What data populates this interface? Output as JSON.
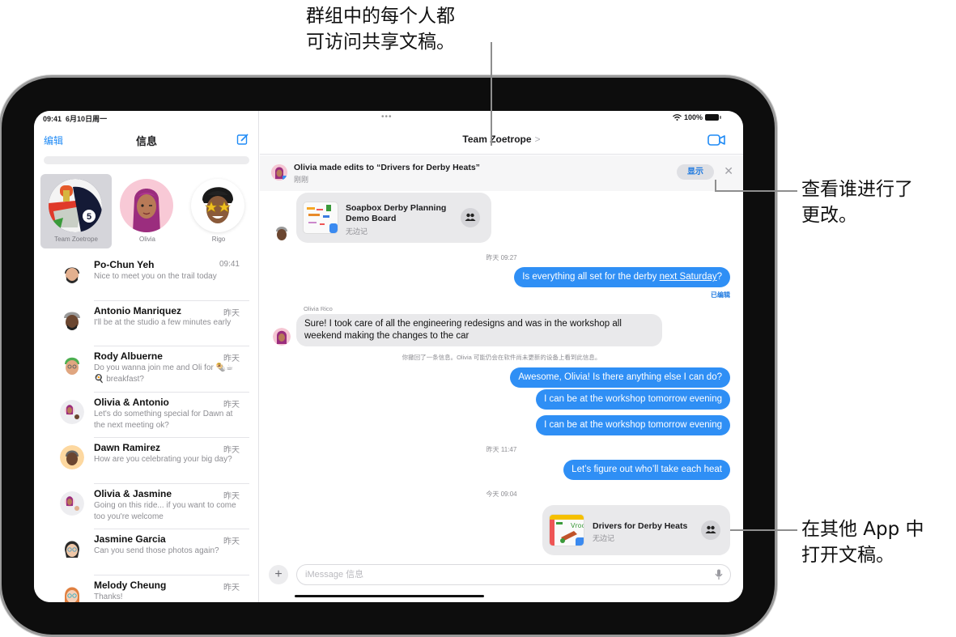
{
  "callouts": {
    "top": [
      "群组中的每个人都",
      "可访问共享文稿。"
    ],
    "right_show": [
      "查看谁进行了",
      "更改。"
    ],
    "right_open": [
      "在其他 App 中",
      "打开文稿。"
    ]
  },
  "status_bar": {
    "time": "09:41",
    "date": "6月10日周一",
    "battery": "100%"
  },
  "sidebar": {
    "edit_label": "编辑",
    "title": "信息",
    "pinned": [
      {
        "name": "Team Zoetrope",
        "selected": true
      },
      {
        "name": "Olivia",
        "selected": false
      },
      {
        "name": "Rigo",
        "selected": false
      }
    ],
    "conversations": [
      {
        "name": "Po-Chun Yeh",
        "time": "09:41",
        "preview": "Nice to meet you on the trail today"
      },
      {
        "name": "Antonio Manriquez",
        "time": "昨天",
        "preview": "I'll be at the studio a few minutes early"
      },
      {
        "name": "Rody Albuerne",
        "time": "昨天",
        "preview": "Do you wanna join me and Oli for 🌯☕🍳 breakfast?"
      },
      {
        "name": "Olivia & Antonio",
        "time": "昨天",
        "preview": "Let's do something special for Dawn at the next meeting ok?"
      },
      {
        "name": "Dawn Ramirez",
        "time": "昨天",
        "preview": "How are you celebrating your big day?"
      },
      {
        "name": "Olivia & Jasmine",
        "time": "昨天",
        "preview": "Going on this ride... if you want to come too you're welcome"
      },
      {
        "name": "Jasmine Garcia",
        "time": "昨天",
        "preview": "Can you send those photos again?"
      },
      {
        "name": "Melody Cheung",
        "time": "昨天",
        "preview": "Thanks!"
      }
    ]
  },
  "chat": {
    "title": "Team Zoetrope",
    "title_chevron": ">",
    "notification": {
      "title": "Olivia made edits to “Drivers for Derby Heats”",
      "subtitle": "刚刚",
      "show_label": "显示",
      "close_glyph": "✕"
    },
    "messages": {
      "card1": {
        "title_line1": "Soapbox Derby Planning",
        "title_line2": "Demo Board",
        "app": "无边记"
      },
      "ts1": "昨天 09:27",
      "out1_prefix": "Is everything all set for the derby ",
      "out1_link": "next Saturday",
      "out1_suffix": "?",
      "edited_label": "已编辑",
      "sender_olivia": "Olivia Rico",
      "in1_line1": "Sure! I took care of all the engineering redesigns and was in the workshop all",
      "in1_line2": "weekend making the changes to the car",
      "unsent_notice": "你撤回了一条信息。Olivia 可能仍会在软件尚未更新的设备上看到此信息。",
      "out2": "Awesome, Olivia! Is there anything else I can do?",
      "out3": "I can be at the workshop tomorrow evening",
      "out4": "I can be at the workshop tomorrow evening",
      "ts2": "昨天 11:47",
      "out5": "Let’s figure out who’ll take each heat",
      "ts3": "今天 09:04",
      "card2": {
        "title": "Drivers for Derby Heats",
        "app": "无边记"
      }
    },
    "composer": {
      "plus_glyph": "+",
      "placeholder": "iMessage 信息"
    }
  },
  "colors": {
    "accent": "#1f8af5",
    "outgoing_bubble": "#2f8ff5",
    "incoming_bubble": "#e9e9eb"
  }
}
